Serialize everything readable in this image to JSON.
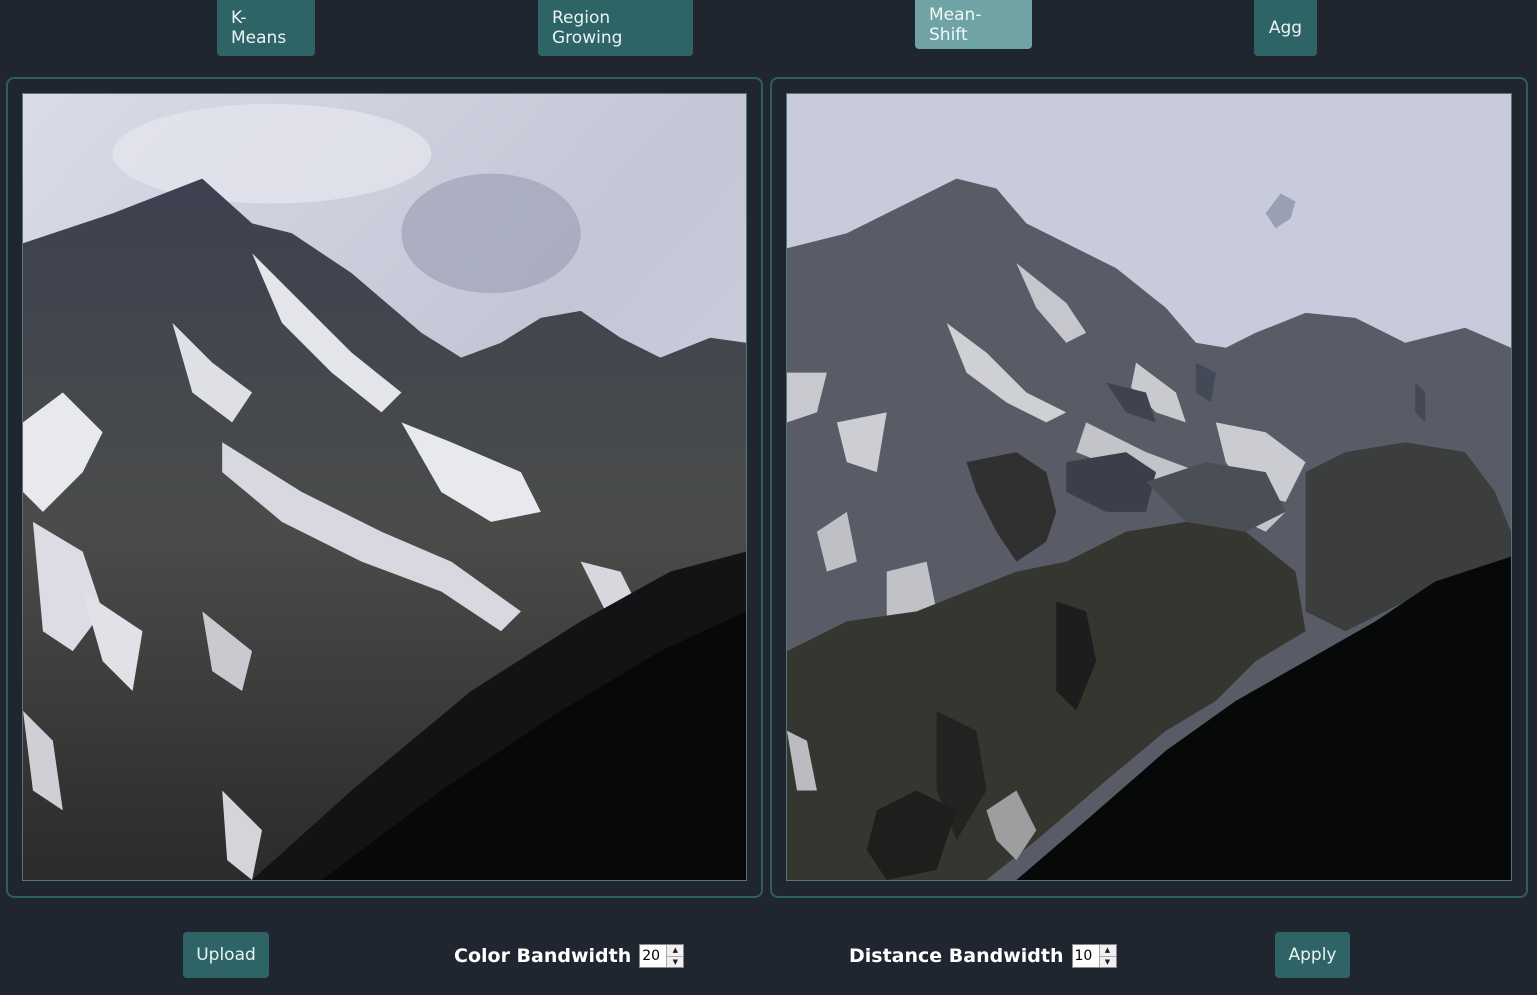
{
  "tabs": [
    {
      "label": "K-Means",
      "active": false
    },
    {
      "label": "Region Growing",
      "active": false
    },
    {
      "label": "Mean-Shift",
      "active": true
    },
    {
      "label": "Agg",
      "active": false
    }
  ],
  "controls": {
    "upload_label": "Upload",
    "color_bandwidth_label": "Color Bandwidth",
    "color_bandwidth_value": "20",
    "distance_bandwidth_label": "Distance Bandwidth",
    "distance_bandwidth_value": "10",
    "apply_label": "Apply"
  },
  "colors": {
    "background": "#1f262f",
    "button": "#2e6466",
    "button_active": "#6fa3a4",
    "panel_border": "#2f5e62"
  },
  "icons": {
    "spin_up": "chevron-up-icon",
    "spin_down": "chevron-down-icon"
  }
}
